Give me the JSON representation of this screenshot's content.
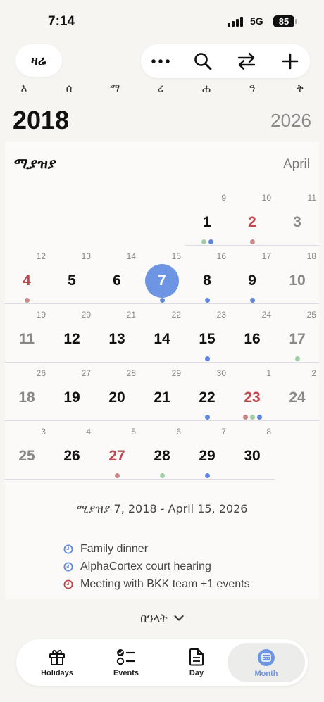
{
  "status_bar": {
    "time": "7:14",
    "network": "5G",
    "battery": "85"
  },
  "header": {
    "today_label": "ዛሬ"
  },
  "toolbar": [
    {
      "icon": "more-icon"
    },
    {
      "icon": "search-icon"
    },
    {
      "icon": "swap-icon"
    },
    {
      "icon": "plus-icon"
    }
  ],
  "weekdays": [
    "እ",
    "ሰ",
    "ማ",
    "ረ",
    "ሐ",
    "ዓ",
    "ቅ"
  ],
  "year": {
    "ethiopian": "2018",
    "gregorian": "2026"
  },
  "month": {
    "ethiopian": "ሚያዝያ",
    "gregorian": "April"
  },
  "days": [
    {
      "eth": "1",
      "greg": "9",
      "col": 4,
      "row": 0,
      "style": "normal",
      "dots": [
        "green",
        "blue"
      ]
    },
    {
      "eth": "2",
      "greg": "10",
      "col": 5,
      "row": 0,
      "style": "red",
      "dots": [
        "red"
      ]
    },
    {
      "eth": "3",
      "greg": "11",
      "col": 6,
      "row": 0,
      "style": "gray",
      "dots": []
    },
    {
      "eth": "4",
      "greg": "12",
      "col": 0,
      "row": 1,
      "style": "red",
      "dots": [
        "red"
      ]
    },
    {
      "eth": "5",
      "greg": "13",
      "col": 1,
      "row": 1,
      "style": "normal",
      "dots": []
    },
    {
      "eth": "6",
      "greg": "14",
      "col": 2,
      "row": 1,
      "style": "normal",
      "dots": []
    },
    {
      "eth": "7",
      "greg": "15",
      "col": 3,
      "row": 1,
      "style": "today",
      "dots": [
        "blue"
      ]
    },
    {
      "eth": "8",
      "greg": "16",
      "col": 4,
      "row": 1,
      "style": "normal",
      "dots": [
        "blue"
      ]
    },
    {
      "eth": "9",
      "greg": "17",
      "col": 5,
      "row": 1,
      "style": "normal",
      "dots": [
        "blue"
      ]
    },
    {
      "eth": "10",
      "greg": "18",
      "col": 6,
      "row": 1,
      "style": "gray",
      "dots": []
    },
    {
      "eth": "11",
      "greg": "19",
      "col": 0,
      "row": 2,
      "style": "gray",
      "dots": []
    },
    {
      "eth": "12",
      "greg": "20",
      "col": 1,
      "row": 2,
      "style": "normal",
      "dots": []
    },
    {
      "eth": "13",
      "greg": "21",
      "col": 2,
      "row": 2,
      "style": "normal",
      "dots": []
    },
    {
      "eth": "14",
      "greg": "22",
      "col": 3,
      "row": 2,
      "style": "normal",
      "dots": []
    },
    {
      "eth": "15",
      "greg": "23",
      "col": 4,
      "row": 2,
      "style": "normal",
      "dots": [
        "blue"
      ]
    },
    {
      "eth": "16",
      "greg": "24",
      "col": 5,
      "row": 2,
      "style": "normal",
      "dots": []
    },
    {
      "eth": "17",
      "greg": "25",
      "col": 6,
      "row": 2,
      "style": "gray",
      "dots": [
        "green"
      ]
    },
    {
      "eth": "18",
      "greg": "26",
      "col": 0,
      "row": 3,
      "style": "gray",
      "dots": []
    },
    {
      "eth": "19",
      "greg": "27",
      "col": 1,
      "row": 3,
      "style": "normal",
      "dots": []
    },
    {
      "eth": "20",
      "greg": "28",
      "col": 2,
      "row": 3,
      "style": "normal",
      "dots": []
    },
    {
      "eth": "21",
      "greg": "29",
      "col": 3,
      "row": 3,
      "style": "normal",
      "dots": []
    },
    {
      "eth": "22",
      "greg": "30",
      "col": 4,
      "row": 3,
      "style": "normal",
      "dots": [
        "blue"
      ]
    },
    {
      "eth": "23",
      "greg": "1",
      "col": 5,
      "row": 3,
      "style": "red",
      "dots": [
        "red",
        "green",
        "blue"
      ]
    },
    {
      "eth": "24",
      "greg": "2",
      "col": 6,
      "row": 3,
      "style": "gray",
      "dots": []
    },
    {
      "eth": "25",
      "greg": "3",
      "col": 0,
      "row": 4,
      "style": "gray",
      "dots": []
    },
    {
      "eth": "26",
      "greg": "4",
      "col": 1,
      "row": 4,
      "style": "normal",
      "dots": []
    },
    {
      "eth": "27",
      "greg": "5",
      "col": 2,
      "row": 4,
      "style": "red",
      "dots": [
        "red"
      ]
    },
    {
      "eth": "28",
      "greg": "6",
      "col": 3,
      "row": 4,
      "style": "normal",
      "dots": [
        "green"
      ]
    },
    {
      "eth": "29",
      "greg": "7",
      "col": 4,
      "row": 4,
      "style": "normal",
      "dots": [
        "blue"
      ]
    },
    {
      "eth": "30",
      "greg": "8",
      "col": 5,
      "row": 4,
      "style": "normal",
      "dots": []
    }
  ],
  "selected_range": "ሚያዝያ 7, 2018 - April 15, 2026",
  "events": [
    {
      "title": "Family dinner",
      "color": "#5f86e0",
      "icon": "clock-icon"
    },
    {
      "title": "AlphaCortex court hearing",
      "color": "#5f86e0",
      "icon": "clock-icon"
    },
    {
      "title": "Meeting with BKK team  +1 events",
      "color": "#c2484f",
      "icon": "clock-icon"
    }
  ],
  "holidays_toggle": "በዓላት",
  "tabs": [
    {
      "label": "Holidays",
      "icon": "gift-icon",
      "active": false
    },
    {
      "label": "Events",
      "icon": "checklist-icon",
      "active": false
    },
    {
      "label": "Day",
      "icon": "document-icon",
      "active": false
    },
    {
      "label": "Month",
      "icon": "calendar-icon",
      "active": true
    }
  ],
  "colors": {
    "accent": "#6e95e4",
    "holiday_red": "#c2484f",
    "background": "#f6f5f2"
  }
}
